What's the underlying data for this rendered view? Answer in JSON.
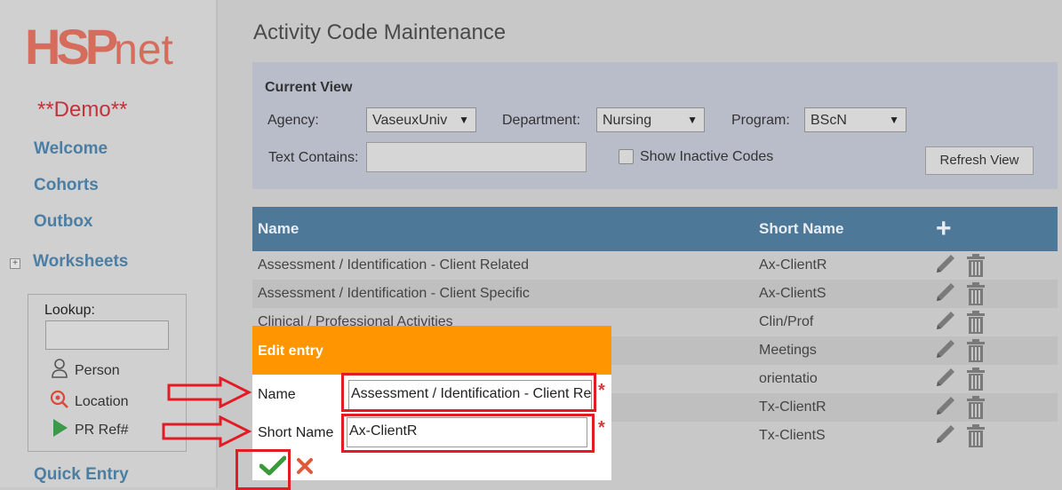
{
  "sidebar": {
    "logo_hsp": "HSP",
    "logo_net": "net",
    "demo": "**Demo**",
    "links": [
      "Welcome",
      "Cohorts",
      "Outbox",
      "Worksheets",
      "Quick Entry"
    ],
    "expand_symbol": "+",
    "lookup": {
      "label": "Lookup",
      "label_suffix": ":",
      "items": [
        "Person",
        "Location",
        "PR Ref#"
      ]
    }
  },
  "page": {
    "title": "Activity Code Maintenance"
  },
  "view": {
    "title": "Current View",
    "agency_label": "Agency:",
    "agency_value": "VaseuxUniv",
    "department_label": "Department:",
    "department_value": "Nursing",
    "program_label": "Program:",
    "program_value": "BScN",
    "text_contains_label": "Text Contains:",
    "text_contains_value": "",
    "show_inactive_label": "Show Inactive Codes",
    "refresh_label": "Refresh View",
    "dropdown_arrow": "▼"
  },
  "table": {
    "col_name": "Name",
    "col_short": "Short Name",
    "add_symbol": "+",
    "rows": [
      {
        "name": "Assessment / Identification - Client Related",
        "short": "Ax-ClientR"
      },
      {
        "name": "Assessment / Identification - Client Specific",
        "short": "Ax-ClientS"
      },
      {
        "name": "Clinical / Professional Activities",
        "short": "Clin/Prof"
      },
      {
        "name": "",
        "short": "Meetings"
      },
      {
        "name": "",
        "short": "orientatio"
      },
      {
        "name": "",
        "short": "Tx-ClientR"
      },
      {
        "name": "",
        "short": "Tx-ClientS"
      }
    ]
  },
  "dialog": {
    "title": "Edit entry",
    "name_label": "Name",
    "name_value": "Assessment / Identification - Client Re",
    "short_label": "Short Name",
    "short_value": "Ax-ClientR",
    "required_mark": "*"
  },
  "colors": {
    "header_blue": "#4d7898",
    "dialog_orange": "#ff9500",
    "annotation_red": "#e21b25",
    "save_green": "#3a9a3a",
    "cancel_red": "#e05a3a"
  }
}
